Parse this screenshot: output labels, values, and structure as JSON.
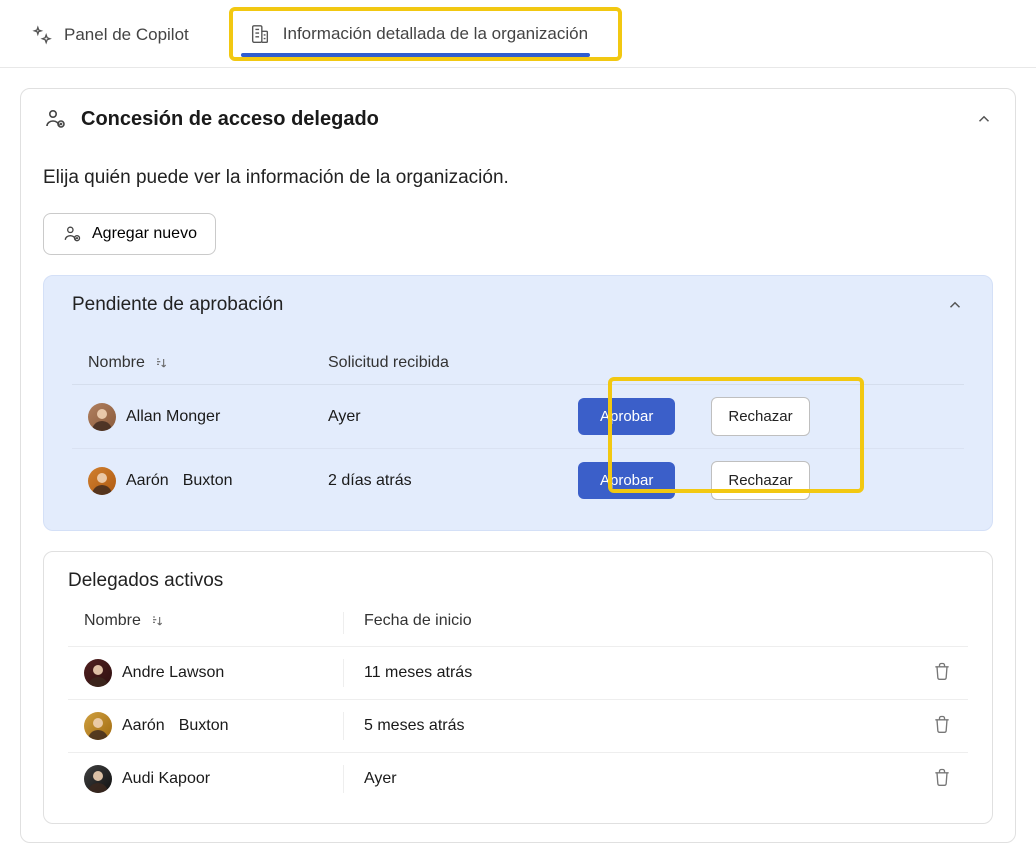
{
  "tabs": {
    "copilot": "Panel de Copilot",
    "org_details": "Información detallada de la organización"
  },
  "card": {
    "title": "Concesión de acceso delegado",
    "description": "Elija quién puede ver la información de la organización.",
    "add_new_label": "Agregar nuevo"
  },
  "pending": {
    "title": "Pendiente de aprobación",
    "col_name": "Nombre",
    "col_received": "Solicitud recibida",
    "approve_label": "Aprobar",
    "reject_label": "Rechazar",
    "rows": [
      {
        "name": "Allan Monger",
        "received": "Ayer"
      },
      {
        "first": "Aarón",
        "last": "Buxton",
        "received": "2 días atrás"
      }
    ]
  },
  "active": {
    "title": "Delegados activos",
    "col_name": "Nombre",
    "col_start": "Fecha de inicio",
    "rows": [
      {
        "name": "Andre Lawson",
        "start": "11 meses atrás"
      },
      {
        "first": "Aarón",
        "last": "Buxton",
        "start": "5 meses atrás"
      },
      {
        "name": "Audi Kapoor",
        "start": "Ayer"
      }
    ]
  }
}
